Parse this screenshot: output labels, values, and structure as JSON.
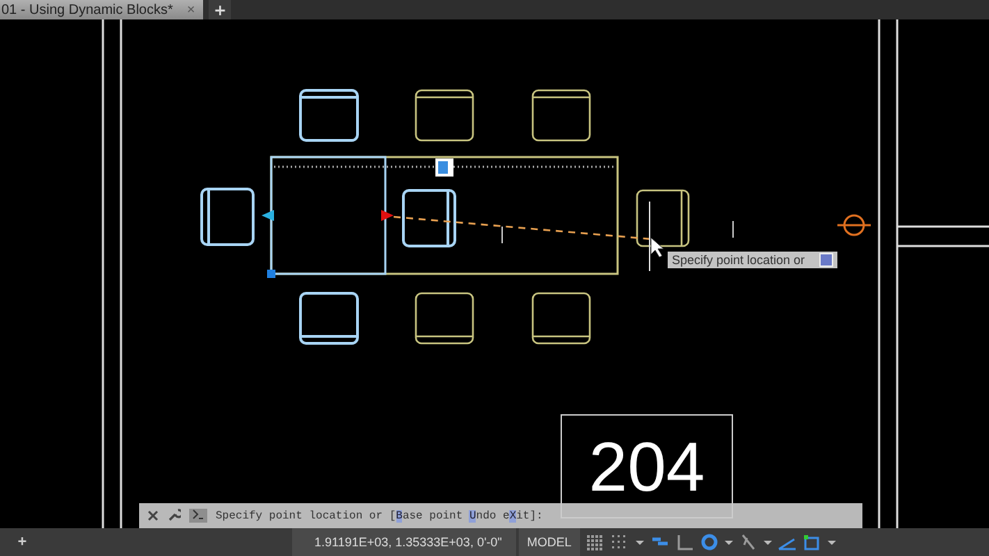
{
  "tabs": [
    {
      "label": "01 - Using Dynamic Blocks*",
      "selected": true,
      "close": "×"
    }
  ],
  "new_tab": "+",
  "drawing": {
    "chairs": [
      {
        "kind": "top",
        "selected": true
      },
      {
        "kind": "top",
        "selected": false
      },
      {
        "kind": "top",
        "selected": false
      },
      {
        "kind": "left",
        "selected": true
      },
      {
        "kind": "right",
        "selected": true
      },
      {
        "kind": "right",
        "selected": false
      },
      {
        "kind": "bottom",
        "selected": true
      },
      {
        "kind": "bottom",
        "selected": false
      },
      {
        "kind": "bottom",
        "selected": false
      }
    ],
    "tooltip": "Specify point location or"
  },
  "command_line": {
    "prompt": "Specify point location or [",
    "options": [
      {
        "key": "B",
        "after": "ase point"
      },
      {
        "key": "U",
        "after": "ndo"
      },
      {
        "before": "e",
        "key": "X",
        "after": "it"
      }
    ],
    "end": "]:"
  },
  "status_bar": {
    "layout_add": "+",
    "coordinates": "1.91191E+03, 1.35333E+03, 0'-0\"",
    "space": "MODEL",
    "toggles": [
      {
        "kind": "grid",
        "on": false
      },
      {
        "kind": "snap",
        "on": false
      },
      {
        "kind": "caret"
      },
      {
        "kind": "infer",
        "on": true
      },
      {
        "kind": "ortho",
        "on": false
      },
      {
        "kind": "polar",
        "on": true
      },
      {
        "kind": "caret"
      },
      {
        "kind": "otrack",
        "on": false
      },
      {
        "kind": "caret"
      },
      {
        "kind": "lineweight",
        "on": true
      },
      {
        "kind": "ucs",
        "on": true
      },
      {
        "kind": "caret"
      }
    ]
  },
  "keystroke_overlay": "204"
}
